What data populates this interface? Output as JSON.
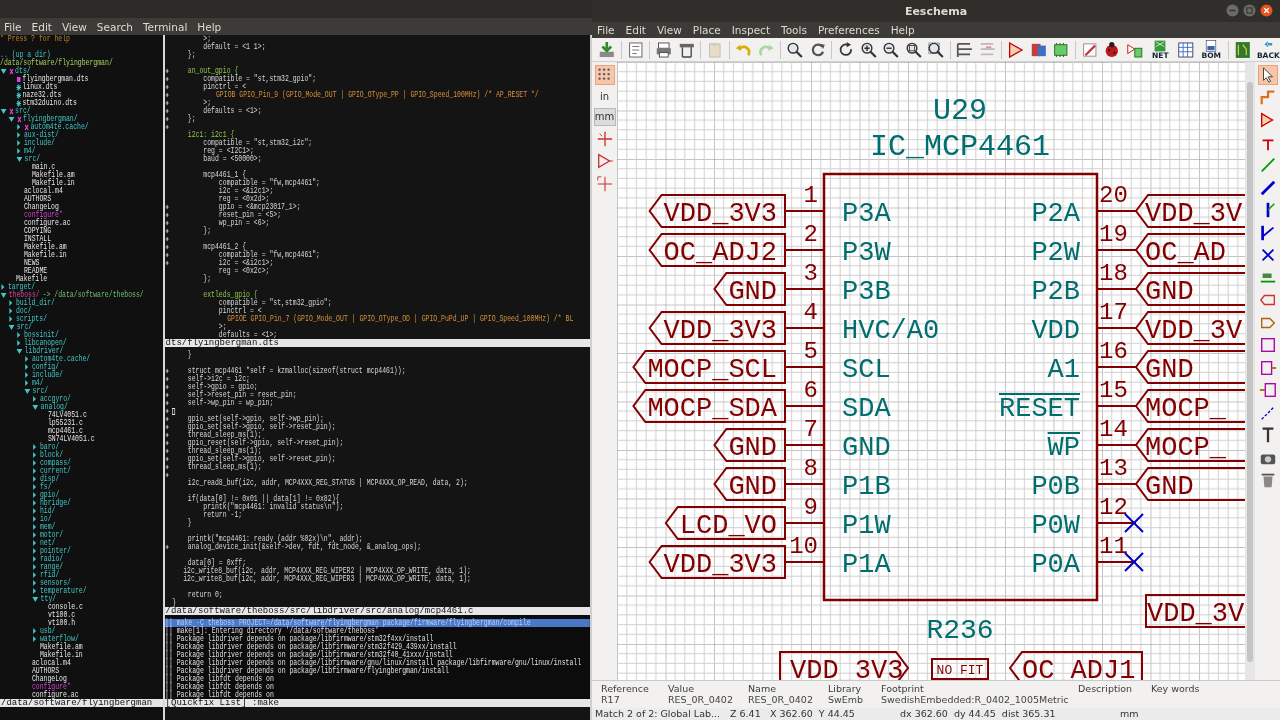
{
  "terminal": {
    "menu": [
      "File",
      "Edit",
      "View",
      "Search",
      "Terminal",
      "Help"
    ],
    "tree": {
      "help": "\" Press ? for help",
      "up": ".. (up a dir)",
      "root": "/data/software/flyingbergman/",
      "items": [
        {
          "name": "dts/",
          "kind": "dir",
          "expanded": true,
          "git": {
            "kind": "dirty"
          },
          "children": [
            {
              "name": "flyingbergman.dts",
              "kind": "file",
              "git": {
                "kind": "staged"
              }
            },
            {
              "name": "linux.dts",
              "kind": "file",
              "git": {
                "kind": "untracked"
              }
            },
            {
              "name": "naze32.dts",
              "kind": "file",
              "git": {
                "kind": "untracked"
              }
            },
            {
              "name": "stm32duino.dts",
              "kind": "file",
              "git": {
                "kind": "untracked"
              }
            }
          ]
        },
        {
          "name": "src/",
          "kind": "dir",
          "expanded": true,
          "git": {
            "kind": "dirty"
          },
          "children": [
            {
              "name": "flyingbergman/",
              "kind": "dir",
              "expanded": true,
              "git": {
                "kind": "dirty"
              },
              "children": [
                {
                  "name": "autom4te.cache/",
                  "kind": "dir",
                  "expanded": false,
                  "git": {
                    "kind": "dirty"
                  }
                },
                {
                  "name": "aux-dist/",
                  "kind": "dir",
                  "expanded": false
                },
                {
                  "name": "include/",
                  "kind": "dir",
                  "expanded": false
                },
                {
                  "name": "m4/",
                  "kind": "dir",
                  "expanded": false
                },
                {
                  "name": "src/",
                  "kind": "dir",
                  "expanded": true,
                  "children": [
                    {
                      "name": "main.c",
                      "kind": "file"
                    },
                    {
                      "name": "Makefile.am",
                      "kind": "file"
                    },
                    {
                      "name": "Makefile.in",
                      "kind": "file"
                    }
                  ]
                },
                {
                  "name": "aclocal.m4",
                  "kind": "file"
                },
                {
                  "name": "AUTHORS",
                  "kind": "file"
                },
                {
                  "name": "ChangeLog",
                  "kind": "file"
                },
                {
                  "name": "configure*",
                  "kind": "exec"
                },
                {
                  "name": "configure.ac",
                  "kind": "file"
                },
                {
                  "name": "COPYING",
                  "kind": "file"
                },
                {
                  "name": "INSTALL",
                  "kind": "file"
                },
                {
                  "name": "Makefile.am",
                  "kind": "file"
                },
                {
                  "name": "Makefile.in",
                  "kind": "file"
                },
                {
                  "name": "NEWS",
                  "kind": "file"
                },
                {
                  "name": "README",
                  "kind": "file"
                }
              ]
            },
            {
              "name": "Makefile",
              "kind": "file"
            }
          ]
        },
        {
          "name": "target/",
          "kind": "dir",
          "expanded": false
        },
        {
          "name": "theboss/",
          "kind": "link",
          "target": "-> /data/software/theboss/",
          "expanded": true,
          "children": [
            {
              "name": "build_dir/",
              "kind": "dir",
              "expanded": false
            },
            {
              "name": "doc/",
              "kind": "dir",
              "expanded": false
            },
            {
              "name": "scripts/",
              "kind": "dir",
              "expanded": false
            },
            {
              "name": "src/",
              "kind": "dir",
              "expanded": true,
              "children": [
                {
                  "name": "bossinit/",
                  "kind": "dir",
                  "expanded": false
                },
                {
                  "name": "libcanopen/",
                  "kind": "dir",
                  "expanded": false
                },
                {
                  "name": "libdriver/",
                  "kind": "dir",
                  "expanded": true,
                  "children": [
                    {
                      "name": "autom4te.cache/",
                      "kind": "dir",
                      "expanded": false
                    },
                    {
                      "name": "config/",
                      "kind": "dir",
                      "expanded": false
                    },
                    {
                      "name": "include/",
                      "kind": "dir",
                      "expanded": false
                    },
                    {
                      "name": "m4/",
                      "kind": "dir",
                      "expanded": false
                    },
                    {
                      "name": "src/",
                      "kind": "dir",
                      "expanded": true,
                      "children": [
                        {
                          "name": "accgyro/",
                          "kind": "dir",
                          "expanded": false
                        },
                        {
                          "name": "analog/",
                          "kind": "dir",
                          "expanded": true,
                          "children": [
                            {
                              "name": "74LV4051.c",
                              "kind": "file"
                            },
                            {
                              "name": "lp55231.c",
                              "kind": "file"
                            },
                            {
                              "name": "mcp4461.c",
                              "kind": "file"
                            },
                            {
                              "name": "SN74LV4051.c",
                              "kind": "file"
                            }
                          ]
                        },
                        {
                          "name": "baro/",
                          "kind": "dir",
                          "expanded": false
                        },
                        {
                          "name": "block/",
                          "kind": "dir",
                          "expanded": false
                        },
                        {
                          "name": "compass/",
                          "kind": "dir",
                          "expanded": false
                        },
                        {
                          "name": "current/",
                          "kind": "dir",
                          "expanded": false
                        },
                        {
                          "name": "disp/",
                          "kind": "dir",
                          "expanded": false
                        },
                        {
                          "name": "fs/",
                          "kind": "dir",
                          "expanded": false
                        },
                        {
                          "name": "gpio/",
                          "kind": "dir",
                          "expanded": false
                        },
                        {
                          "name": "hbridge/",
                          "kind": "dir",
                          "expanded": false
                        },
                        {
                          "name": "hid/",
                          "kind": "dir",
                          "expanded": false
                        },
                        {
                          "name": "io/",
                          "kind": "dir",
                          "expanded": false
                        },
                        {
                          "name": "mem/",
                          "kind": "dir",
                          "expanded": false
                        },
                        {
                          "name": "motor/",
                          "kind": "dir",
                          "expanded": false
                        },
                        {
                          "name": "net/",
                          "kind": "dir",
                          "expanded": false
                        },
                        {
                          "name": "pointer/",
                          "kind": "dir",
                          "expanded": false
                        },
                        {
                          "name": "radio/",
                          "kind": "dir",
                          "expanded": false
                        },
                        {
                          "name": "range/",
                          "kind": "dir",
                          "expanded": false
                        },
                        {
                          "name": "rfid/",
                          "kind": "dir",
                          "expanded": false
                        },
                        {
                          "name": "sensors/",
                          "kind": "dir",
                          "expanded": false
                        },
                        {
                          "name": "temperature/",
                          "kind": "dir",
                          "expanded": false
                        },
                        {
                          "name": "tty/",
                          "kind": "dir",
                          "expanded": true,
                          "children": [
                            {
                              "name": "console.c",
                              "kind": "file"
                            },
                            {
                              "name": "vt100.c",
                              "kind": "file"
                            },
                            {
                              "name": "vt100.h",
                              "kind": "file"
                            }
                          ]
                        },
                        {
                          "name": "usb/",
                          "kind": "dir",
                          "expanded": false
                        },
                        {
                          "name": "waterflow/",
                          "kind": "dir",
                          "expanded": false
                        },
                        {
                          "name": "Makefile.am",
                          "kind": "file"
                        },
                        {
                          "name": "Makefile.in",
                          "kind": "file"
                        }
                      ]
                    },
                    {
                      "name": "aclocal.m4",
                      "kind": "file"
                    },
                    {
                      "name": "AUTHORS",
                      "kind": "file"
                    },
                    {
                      "name": "ChangeLog",
                      "kind": "file"
                    },
                    {
                      "name": "configure*",
                      "kind": "exec"
                    },
                    {
                      "name": "configure.ac",
                      "kind": "file"
                    }
                  ]
                }
              ]
            }
          ]
        }
      ],
      "status": "/data/software/flyingbergman"
    },
    "panes": [
      {
        "lines": [
          {
            "text": "        >;",
            "added": false,
            "kind": "code"
          },
          {
            "text": "        default = <1 1>;",
            "added": false,
            "kind": "code"
          },
          {
            "text": "    };",
            "added": false,
            "kind": "code"
          },
          {
            "added": false,
            "kind": "code"
          },
          {
            "text": "    an_out_gpio {",
            "added": true,
            "kind": "label"
          },
          {
            "text": "        compatible = \"st,stm32_gpio\";",
            "added": true,
            "kind": "code"
          },
          {
            "text": "        pinctrl = <",
            "added": true,
            "kind": "code"
          },
          {
            "text": "            GPIOB GPIO_Pin_9 (GPIO_Mode_OUT | GPIO_OType_PP | GPIO_Speed_100MHz) /* AP_RESET */",
            "added": true,
            "kind": "macro"
          },
          {
            "text": "        >;",
            "added": true,
            "kind": "code"
          },
          {
            "text": "        defaults = <1>;",
            "added": true,
            "kind": "code"
          },
          {
            "text": "    };",
            "added": true,
            "kind": "code"
          },
          {
            "added": true,
            "kind": "code"
          },
          {
            "text": "    i2c1: i2c1 {",
            "added": false,
            "kind": "label"
          },
          {
            "text": "        compatible = \"st,stm32_i2c\";",
            "added": false,
            "kind": "code"
          },
          {
            "text": "        reg = <I2C1>;",
            "added": false,
            "kind": "code"
          },
          {
            "text": "        baud = <50000>;",
            "added": false,
            "kind": "code"
          },
          {
            "added": false,
            "kind": "code"
          },
          {
            "text": "        mcp4461_1 {",
            "added": false,
            "kind": "code"
          },
          {
            "text": "            compatible = \"fw,mcp4461\";",
            "added": false,
            "kind": "code"
          },
          {
            "text": "            i2c = <&i2c1>;",
            "added": false,
            "kind": "code"
          },
          {
            "text": "            reg = <0x2d>;",
            "added": false,
            "kind": "code"
          },
          {
            "text": "            gpio = <&mcp23017_1>;",
            "added": true,
            "kind": "code"
          },
          {
            "text": "            reset_pin = <5>;",
            "added": true,
            "kind": "code"
          },
          {
            "text": "            wp_pin = <6>;",
            "added": true,
            "kind": "code"
          },
          {
            "text": "        };",
            "added": true,
            "kind": "code"
          },
          {
            "added": true,
            "kind": "code"
          },
          {
            "text": "        mcp4461_2 {",
            "added": true,
            "kind": "code"
          },
          {
            "text": "            compatible = \"fw,mcp4461\";",
            "added": true,
            "kind": "code"
          },
          {
            "text": "            i2c = <&i2c1>;",
            "added": true,
            "kind": "code"
          },
          {
            "text": "            reg = <0x2c>;",
            "added": false,
            "kind": "code"
          },
          {
            "text": "        };",
            "added": false,
            "kind": "code"
          },
          {
            "added": false,
            "kind": "code"
          },
          {
            "text": "        extleds_gpio {",
            "added": false,
            "kind": "label"
          },
          {
            "text": "            compatible = \"st,stm32_gpio\";",
            "added": false,
            "kind": "code"
          },
          {
            "text": "            pinctrl = <",
            "added": false,
            "kind": "code"
          },
          {
            "text": "                GPIOE GPIO_Pin_7 (GPIO_Mode_OUT | GPIO_OType_OD | GPIO_PuPd_UP | GPIO_Speed_100MHz) /* BL",
            "added": false,
            "kind": "macro"
          },
          {
            "text": "            >;",
            "added": false,
            "kind": "code"
          },
          {
            "text": "            defaults = <1>;",
            "added": false,
            "kind": "code"
          }
        ],
        "status": "dts/flyingbergman.dts"
      },
      {
        "lines": [
          {
            "text": "    }",
            "added": false,
            "kind": "code"
          },
          {
            "added": false,
            "kind": "code"
          },
          {
            "text": "    struct mcp4461 *self = kzmalloc(sizeof(struct mcp4461));",
            "added": true,
            "kind": "code"
          },
          {
            "text": "    self->i2c = i2c;",
            "added": true,
            "kind": "code"
          },
          {
            "text": "    self->gpio = gpio;",
            "added": true,
            "kind": "code"
          },
          {
            "text": "    self->reset_pin = reset_pin;",
            "added": true,
            "kind": "code"
          },
          {
            "text": "    self->wp_pin = wp_pin;",
            "added": true,
            "kind": "code"
          },
          {
            "added": true,
            "kind": "code",
            "cursor": true
          },
          {
            "text": "    gpio_set(self->gpio, self->wp_pin);",
            "added": true,
            "kind": "code"
          },
          {
            "text": "    gpio_set(self->gpio, self->reset_pin);",
            "added": true,
            "kind": "code"
          },
          {
            "text": "    thread_sleep_ms(1);",
            "added": true,
            "kind": "code"
          },
          {
            "text": "    gpio_reset(self->gpio, self->reset_pin);",
            "added": true,
            "kind": "code"
          },
          {
            "text": "    thread_sleep_ms(1);",
            "added": true,
            "kind": "code"
          },
          {
            "text": "    gpio_set(self->gpio, self->reset_pin);",
            "added": true,
            "kind": "code"
          },
          {
            "text": "    thread_sleep_ms(1);",
            "added": true,
            "kind": "code"
          },
          {
            "added": true,
            "kind": "code"
          },
          {
            "text": "    i2c_read8_buf(i2c, addr, MCP4XXX_REG_STATUS | MCP4XXX_OP_READ, data, 2);",
            "added": false,
            "kind": "code"
          },
          {
            "added": false,
            "kind": "code"
          },
          {
            "text": "    if(data[0] != 0x01 || data[1] != 0x82){",
            "added": false,
            "kind": "code"
          },
          {
            "text": "        printk(\"mcp4461: invalid status\\n\");",
            "added": false,
            "kind": "code"
          },
          {
            "text": "        return -1;",
            "added": false,
            "kind": "code"
          },
          {
            "text": "    }",
            "added": false,
            "kind": "code"
          },
          {
            "added": false,
            "kind": "code"
          },
          {
            "text": "    printk(\"mcp4461: ready (addr %02x)\\n\", addr);",
            "added": false,
            "kind": "code"
          },
          {
            "text": "    analog_device_init(&self->dev, fdt, fdt_node, &_analog_ops);",
            "added": true,
            "kind": "code"
          },
          {
            "added": false,
            "kind": "code"
          },
          {
            "text": "    data[0] = 0xff;",
            "added": false,
            "kind": "code"
          },
          {
            "text": "    i2c_write8_buf(i2c, addr, MCP4XXX_REG_WIPER2 | MCP4XXX_OP_WRITE, data, 1);",
            "added": false,
            "kind": "code"
          },
          {
            "text": "    i2c_write8_buf(i2c, addr, MCP4XXX_REG_WIPER3 | MCP4XXX_OP_WRITE, data, 1);",
            "added": false,
            "kind": "code"
          },
          {
            "added": false,
            "kind": "code"
          },
          {
            "text": "    return 0;",
            "added": false,
            "kind": "code"
          },
          {
            "text": "}",
            "added": false,
            "kind": "code"
          }
        ],
        "status": "/data/software/theboss/src/libdriver/src/analog/mcp4461.c"
      }
    ],
    "quickfix": {
      "lines": [
        {
          "text": "|| make -C theboss PROJECT=/data/software/flyingbergman package/firmware/flyingbergman/compile",
          "selected": true
        },
        {
          "text": "|| make[1]: Entering directory '/data/software/theboss'",
          "selected": false
        },
        {
          "text": "|| Package libdriver depends on package/libfirmware/stm32f4xx/install",
          "selected": false
        },
        {
          "text": "|| Package libdriver depends on package/libfirmware/stm32f429_439xx/install",
          "selected": false
        },
        {
          "text": "|| Package libdriver depends on package/libfirmware/stm32f40_41xxx/install",
          "selected": false
        },
        {
          "text": "|| Package libdriver depends on package/libfirmware/gnu/linux/install package/libfirmware/gnu/linux/install",
          "selected": false
        },
        {
          "text": "|| Package libdriver depends on package/libfirmware/flyingbergman/install",
          "selected": false
        },
        {
          "text": "|| Package libfdt depends on",
          "selected": false
        },
        {
          "text": "|| Package libfdt depends on",
          "selected": false
        },
        {
          "text": "|| Package libfdt depends on",
          "selected": false
        }
      ],
      "status": "[Quickfix List] :make"
    }
  },
  "eeschema": {
    "title": "Eeschema",
    "menu": [
      "File",
      "Edit",
      "View",
      "Place",
      "Inspect",
      "Tools",
      "Preferences",
      "Help"
    ],
    "toolbar_labels": {
      "netlist": "NET",
      "bom": "BOM",
      "back": "BACK"
    },
    "grid_shown": true,
    "units": [
      {
        "label": "in",
        "selected": false
      },
      {
        "label": "mm",
        "selected": true
      }
    ],
    "schematic": {
      "reference": "U29",
      "value": "IC_MCP4461",
      "left_pins": [
        {
          "number": "1",
          "name": "P3A",
          "label": "VDD_3V3",
          "inverted": false
        },
        {
          "number": "2",
          "name": "P3W",
          "label": "OC_ADJ2",
          "inverted": false
        },
        {
          "number": "3",
          "name": "P3B",
          "label": "GND",
          "inverted": false
        },
        {
          "number": "4",
          "name": "HVC/A0",
          "label": "VDD_3V3",
          "inverted": false
        },
        {
          "number": "5",
          "name": "SCL",
          "label": "MOCP_SCL",
          "inverted": false
        },
        {
          "number": "6",
          "name": "SDA",
          "label": "MOCP_SDA",
          "inverted": false
        },
        {
          "number": "7",
          "name": "GND",
          "label": "GND",
          "inverted": false
        },
        {
          "number": "8",
          "name": "P1B",
          "label": "GND",
          "inverted": false
        },
        {
          "number": "9",
          "name": "P1W",
          "label": "LCD_VO",
          "inverted": false
        },
        {
          "number": "10",
          "name": "P1A",
          "label": "VDD_3V3",
          "inverted": false
        }
      ],
      "right_pins": [
        {
          "number": "20",
          "name": "P2A",
          "label": "VDD_3V",
          "inverted": false,
          "no_connect": false
        },
        {
          "number": "19",
          "name": "P2W",
          "label": "OC_AD",
          "inverted": false,
          "no_connect": false
        },
        {
          "number": "18",
          "name": "P2B",
          "label": "GND",
          "inverted": false,
          "no_connect": false
        },
        {
          "number": "17",
          "name": "VDD",
          "label": "VDD_3V",
          "inverted": false,
          "no_connect": false
        },
        {
          "number": "16",
          "name": "A1",
          "label": "GND",
          "inverted": false,
          "no_connect": false
        },
        {
          "number": "15",
          "name": "RESET",
          "label": "MOCP_",
          "inverted": true,
          "no_connect": false
        },
        {
          "number": "14",
          "name": "WP",
          "label": "MOCP_",
          "inverted": true,
          "no_connect": false
        },
        {
          "number": "13",
          "name": "P0B",
          "label": "GND",
          "inverted": false,
          "no_connect": false
        },
        {
          "number": "12",
          "name": "P0W",
          "inverted": false,
          "no_connect": true
        },
        {
          "number": "11",
          "name": "P0A",
          "inverted": false,
          "no_connect": true
        }
      ],
      "resistor": {
        "reference": "R236",
        "left_label": "VDD_3V3",
        "note": "NO FIT",
        "right_label": "OC_ADJ1"
      },
      "corner_label": "VDD_3V"
    },
    "info": [
      {
        "label": "Reference",
        "value": "R17"
      },
      {
        "label": "Value",
        "value": "RES_0R_0402"
      },
      {
        "label": "Name",
        "value": "RES_0R_0402"
      },
      {
        "label": "Library",
        "value": "SwEmb"
      },
      {
        "label": "Footprint",
        "value": "SwedishEmbedded:R_0402_1005Metric"
      },
      {
        "label": "Description"
      },
      {
        "label": "Key words"
      }
    ],
    "status": [
      "Match 2 of 2: Global Lab...",
      "Z 6.41",
      "X 362.60  Y 44.45",
      "dx 362.60  dy 44.45  dist 365.31",
      "mm"
    ]
  }
}
